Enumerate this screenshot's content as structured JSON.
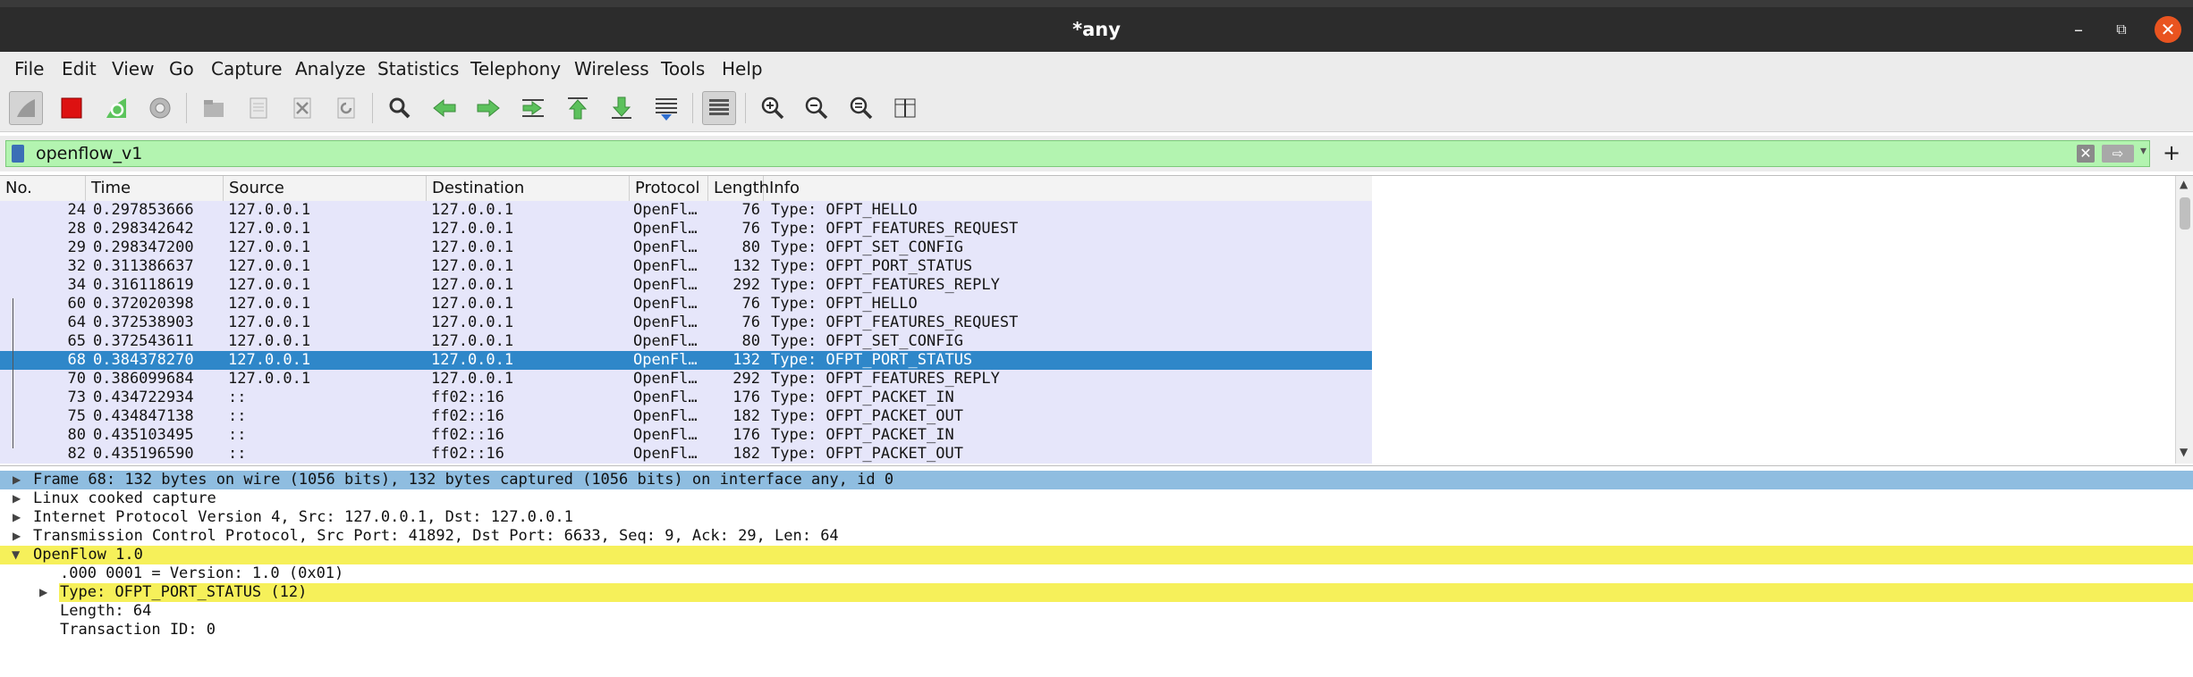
{
  "window": {
    "title": "*any",
    "minimize_glyph": "–",
    "maximize_glyph": "⧉",
    "close_glyph": "✕"
  },
  "menu": [
    "File",
    "Edit",
    "View",
    "Go",
    "Capture",
    "Analyze",
    "Statistics",
    "Telephony",
    "Wireless",
    "Tools",
    "Help"
  ],
  "filter": {
    "value": "openflow_v1",
    "clear_glyph": "✕",
    "apply_glyph": "⇨",
    "dropdown_glyph": "▾",
    "add_glyph": "+"
  },
  "columns": [
    "No.",
    "Time",
    "Source",
    "Destination",
    "Protocol",
    "Length",
    "Info"
  ],
  "packets": [
    {
      "no": "24",
      "time": "0.297853666",
      "src": "127.0.0.1",
      "dst": "127.0.0.1",
      "proto": "OpenFl…",
      "len": "76",
      "info": "Type: OFPT_HELLO"
    },
    {
      "no": "28",
      "time": "0.298342642",
      "src": "127.0.0.1",
      "dst": "127.0.0.1",
      "proto": "OpenFl…",
      "len": "76",
      "info": "Type: OFPT_FEATURES_REQUEST"
    },
    {
      "no": "29",
      "time": "0.298347200",
      "src": "127.0.0.1",
      "dst": "127.0.0.1",
      "proto": "OpenFl…",
      "len": "80",
      "info": "Type: OFPT_SET_CONFIG"
    },
    {
      "no": "32",
      "time": "0.311386637",
      "src": "127.0.0.1",
      "dst": "127.0.0.1",
      "proto": "OpenFl…",
      "len": "132",
      "info": "Type: OFPT_PORT_STATUS"
    },
    {
      "no": "34",
      "time": "0.316118619",
      "src": "127.0.0.1",
      "dst": "127.0.0.1",
      "proto": "OpenFl…",
      "len": "292",
      "info": "Type: OFPT_FEATURES_REPLY"
    },
    {
      "no": "60",
      "time": "0.372020398",
      "src": "127.0.0.1",
      "dst": "127.0.0.1",
      "proto": "OpenFl…",
      "len": "76",
      "info": "Type: OFPT_HELLO"
    },
    {
      "no": "64",
      "time": "0.372538903",
      "src": "127.0.0.1",
      "dst": "127.0.0.1",
      "proto": "OpenFl…",
      "len": "76",
      "info": "Type: OFPT_FEATURES_REQUEST"
    },
    {
      "no": "65",
      "time": "0.372543611",
      "src": "127.0.0.1",
      "dst": "127.0.0.1",
      "proto": "OpenFl…",
      "len": "80",
      "info": "Type: OFPT_SET_CONFIG"
    },
    {
      "no": "68",
      "time": "0.384378270",
      "src": "127.0.0.1",
      "dst": "127.0.0.1",
      "proto": "OpenFl…",
      "len": "132",
      "info": "Type: OFPT_PORT_STATUS",
      "selected": true
    },
    {
      "no": "70",
      "time": "0.386099684",
      "src": "127.0.0.1",
      "dst": "127.0.0.1",
      "proto": "OpenFl…",
      "len": "292",
      "info": "Type: OFPT_FEATURES_REPLY"
    },
    {
      "no": "73",
      "time": "0.434722934",
      "src": "::",
      "dst": "ff02::16",
      "proto": "OpenFl…",
      "len": "176",
      "info": "Type: OFPT_PACKET_IN"
    },
    {
      "no": "75",
      "time": "0.434847138",
      "src": "::",
      "dst": "ff02::16",
      "proto": "OpenFl…",
      "len": "182",
      "info": "Type: OFPT_PACKET_OUT"
    },
    {
      "no": "80",
      "time": "0.435103495",
      "src": "::",
      "dst": "ff02::16",
      "proto": "OpenFl…",
      "len": "176",
      "info": "Type: OFPT_PACKET_IN"
    },
    {
      "no": "82",
      "time": "0.435196590",
      "src": "::",
      "dst": "ff02::16",
      "proto": "OpenFl…",
      "len": "182",
      "info": "Type: OFPT_PACKET_OUT"
    }
  ],
  "details": {
    "frame": "Frame 68: 132 bytes on wire (1056 bits), 132 bytes captured (1056 bits) on interface any, id 0",
    "linux": "Linux cooked capture",
    "ip": "Internet Protocol Version 4, Src: 127.0.0.1, Dst: 127.0.0.1",
    "tcp": "Transmission Control Protocol, Src Port: 41892, Dst Port: 6633, Seq: 9, Ack: 29, Len: 64",
    "openflow": "OpenFlow 1.0",
    "version": ".000 0001 = Version: 1.0 (0x01)",
    "type": "Type: OFPT_PORT_STATUS (12)",
    "length": "Length: 64",
    "xid": "Transaction ID: 0"
  },
  "colors": {
    "row_bg": "#e6e6fa",
    "selected_bg": "#2f87c9",
    "filter_valid_bg": "#b3f4b0",
    "highlight": "#f6f05a",
    "close_button": "#e95420"
  }
}
